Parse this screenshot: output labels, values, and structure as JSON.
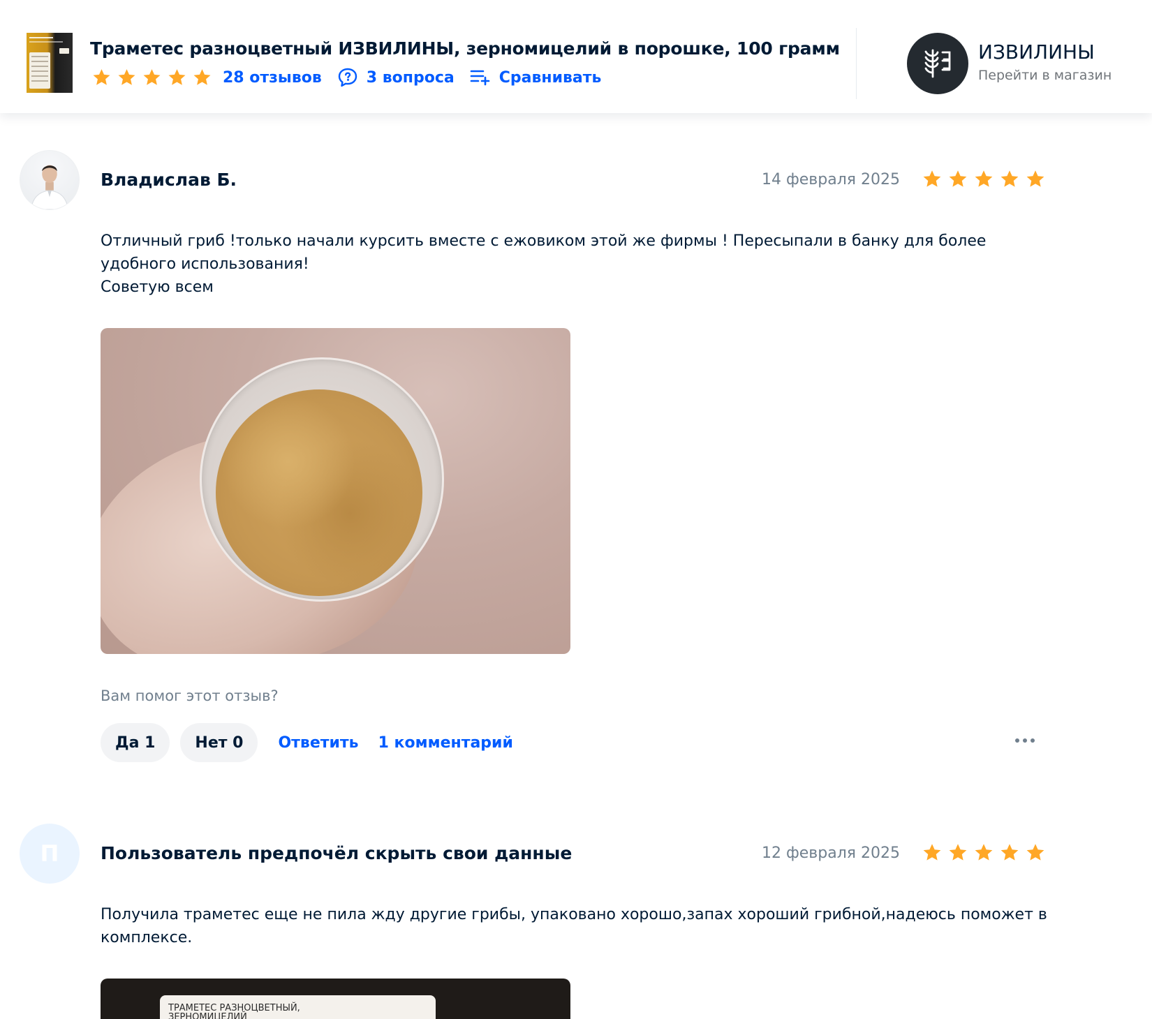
{
  "colors": {
    "accent": "#005bff",
    "star": "#ffa726",
    "text": "#001a34",
    "muted": "#707f8d"
  },
  "header": {
    "product_title": "Траметес разноцветный ИЗВИЛИНЫ, зерномицелий в порошке, 100 грамм",
    "rating_stars": 5,
    "reviews_link": "28 отзывов",
    "questions_link": "3 вопроса",
    "compare_link": "Сравнивать",
    "shop": {
      "name": "ИЗВИЛИНЫ",
      "go_to_shop": "Перейти в магазин"
    }
  },
  "reviews": [
    {
      "author": "Владислав Б.",
      "date": "14 февраля 2025",
      "rating": 5,
      "text": "Отличный гриб !только начали курсить вместе с ежовиком этой же фирмы ! Пересыпали в банку для более удобного использования!\nСоветую всем",
      "helpful_question": "Вам помог этот отзыв?",
      "yes_label": "Да 1",
      "no_label": "Нет 0",
      "reply_label": "Ответить",
      "comments_label": "1 комментарий"
    },
    {
      "author": "Пользователь предпочёл скрыть свои данные",
      "avatar_letter": "П",
      "date": "12 февраля 2025",
      "rating": 5,
      "text": "Получила траметес еще не пила жду другие грибы, упаковано хорошо,запах хороший грибной,надеюсь поможет в комплексе.",
      "photo_label": "ТРАМЕТЕС РАЗНОЦВЕТНЫЙ,\nЗЕРНОМИЦЕЛИЙ"
    }
  ]
}
